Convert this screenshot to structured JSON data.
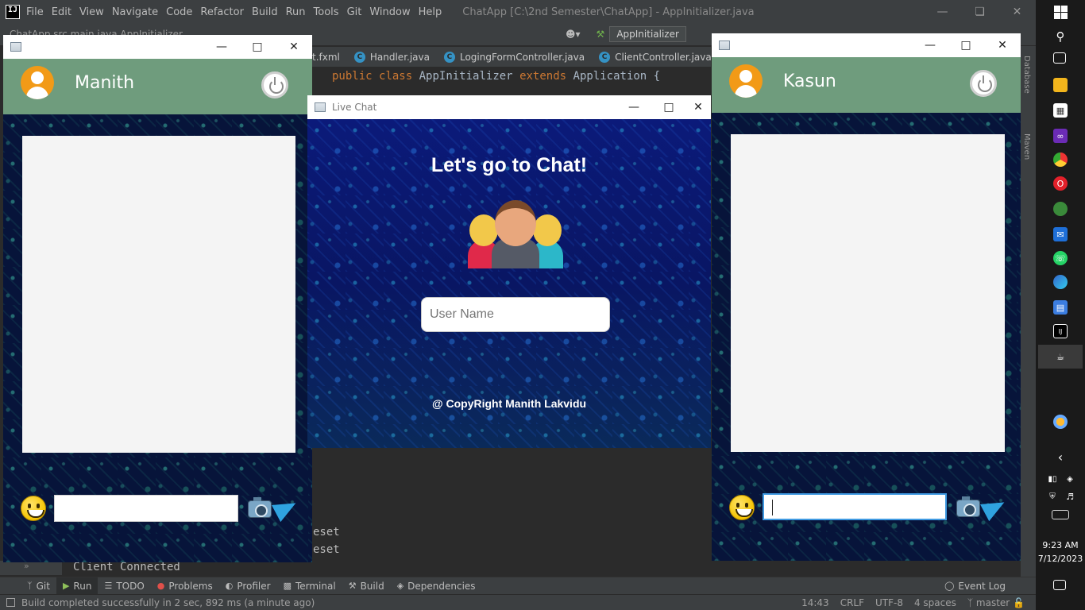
{
  "ide": {
    "menu": [
      "File",
      "Edit",
      "View",
      "Navigate",
      "Code",
      "Refactor",
      "Build",
      "Run",
      "Tools",
      "Git",
      "Window",
      "Help"
    ],
    "title": "ChatApp [C:\\2nd Semester\\ChatApp] - AppInitializer.java",
    "breadcrumb": "ChatApp  src  main  java  AppInitializer",
    "run_config": "AppInitializer",
    "tabs": [
      "t.fxml",
      "Handler.java",
      "LogingFormController.java",
      "ClientController.java"
    ],
    "code_line": {
      "kw1": "public",
      "kw2": "class",
      "name": "AppInitializer",
      "kw3": "extends",
      "rest": "Application {"
    },
    "console": [
      "eset",
      "eset",
      "Client Connected"
    ],
    "right_tools": [
      "Database",
      "Maven"
    ],
    "toolbar": [
      "Git",
      "Run",
      "TODO",
      "Problems",
      "Profiler",
      "Terminal",
      "Build",
      "Dependencies"
    ],
    "event_log": "Event Log",
    "status_message": "Build completed successfully in 2 sec, 892 ms (a minute ago)",
    "status_right": [
      "14:43",
      "CRLF",
      "UTF-8",
      "4 spaces",
      "master"
    ]
  },
  "windows_taskbar": {
    "time": "9:23 AM",
    "date": "7/12/2023"
  },
  "client_left": {
    "name": "Manith",
    "message_value": ""
  },
  "client_right": {
    "name": "Kasun",
    "message_value": ""
  },
  "login": {
    "window_title": "Live Chat",
    "heading": "Let's go to Chat!",
    "username_placeholder": "User Name",
    "copyright": "@ CopyRight Manith Lakvidu"
  },
  "colors": {
    "header_green": "#6f9c7d",
    "ide_dark": "#2b2b2b",
    "input_focus": "#3f9ae2"
  }
}
